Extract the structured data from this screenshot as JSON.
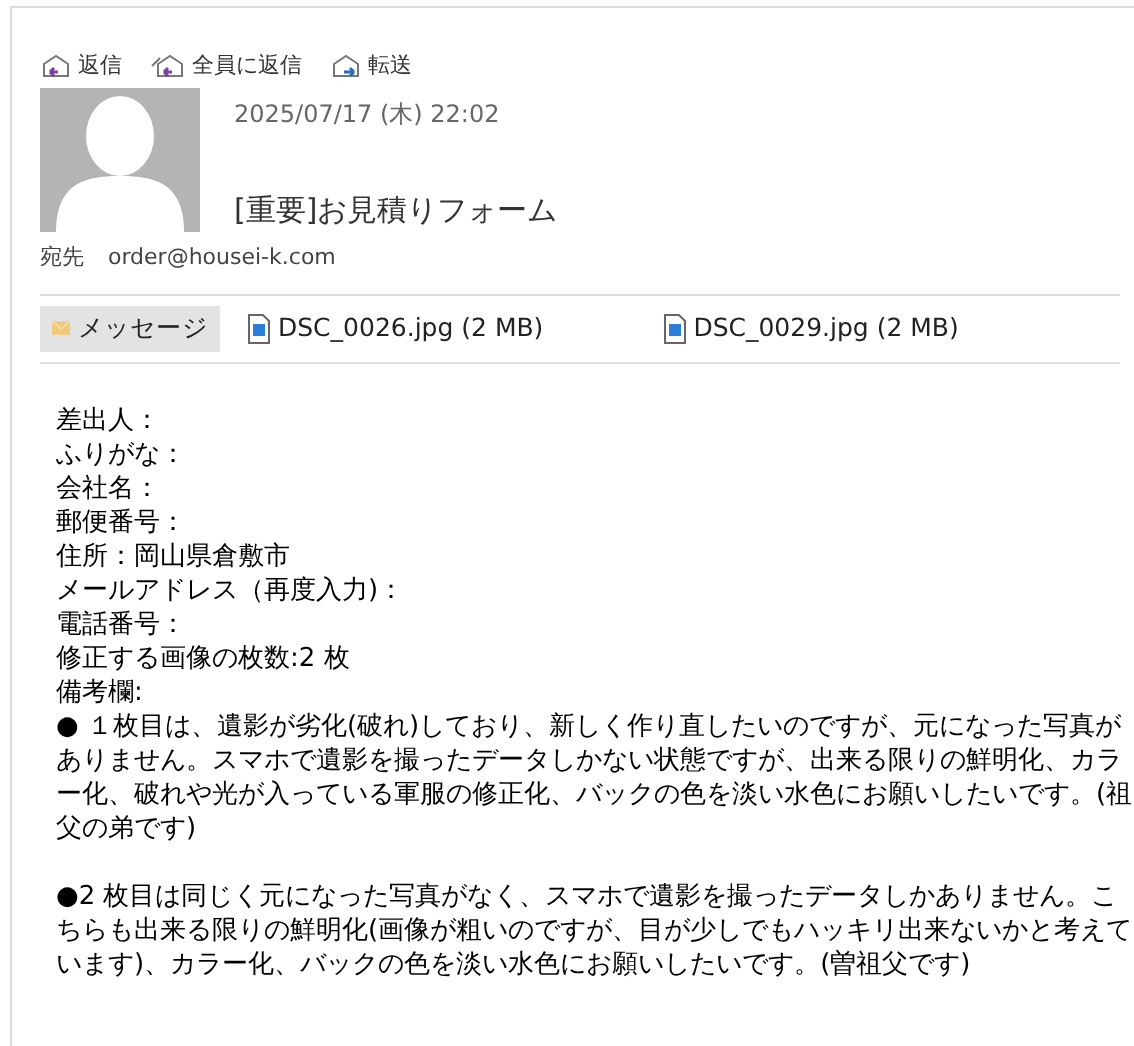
{
  "toolbar": [
    {
      "label": "返信",
      "kind": "reply"
    },
    {
      "label": "全員に返信",
      "kind": "reply-all"
    },
    {
      "label": "転送",
      "kind": "forward"
    }
  ],
  "header": {
    "date": "2025/07/17 (木) 22:02",
    "subject": "[重要]お見積りフォーム",
    "to_label": "宛先",
    "to": "order@housei-k.com"
  },
  "tabs": [
    {
      "label": "メッセージ",
      "kind": "message",
      "selected": true
    },
    {
      "label": "DSC_0026.jpg (2 MB)",
      "kind": "attachment",
      "selected": false
    },
    {
      "label": "DSC_0029.jpg (2 MB)",
      "kind": "attachment",
      "selected": false
    }
  ],
  "body": {
    "lines": [
      "差出人：",
      "ふりがな：",
      "会社名：",
      "郵便番号：",
      "住所：岡山県倉敷市",
      "メールアドレス（再度入力)：",
      "電話番号：",
      "修正する画像の枚数:2 枚",
      "備考欄:"
    ],
    "paragraphs": [
      "● １枚目は、遺影が劣化(破れ)しており、新しく作り直したいのですが、元になった写真がありません。スマホで遺影を撮ったデータしかない状態ですが、出来る限りの鮮明化、カラー化、破れや光が入っている軍服の修正化、バックの色を淡い水色にお願いしたいです。(祖父の弟です)",
      "●2 枚目は同じく元になった写真がなく、スマホで遺影を撮ったデータしかありません。こちらも出来る限りの鮮明化(画像が粗いのですが、目が少しでもハッキリ出来ないかと考えています)、カラー化、バックの色を淡い水色にお願いしたいです。(曽祖父です)"
    ]
  }
}
